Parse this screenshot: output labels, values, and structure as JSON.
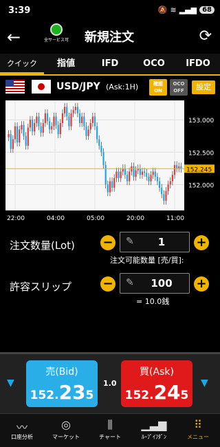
{
  "status": {
    "time": "3:39",
    "battery": "68"
  },
  "header": {
    "service_label": "全サービス可",
    "title": "新規注文"
  },
  "tabs": [
    "クイック",
    "指値",
    "IFD",
    "OCO",
    "IFDO"
  ],
  "pair": {
    "name": "USD/JPY",
    "ask_label": "(Ask:1H)",
    "confirm_title": "確認",
    "confirm_state": "ON",
    "oco_title": "OCO",
    "oco_state": "OFF",
    "settings_label": "設定"
  },
  "chart_data": {
    "type": "candlestick",
    "x_ticks": [
      "22:00",
      "04:00",
      "05:00",
      "20:00",
      "11:00"
    ],
    "y_ticks": [
      "153.000",
      "152.500",
      "152.000"
    ],
    "current_price_label": "152.245",
    "ylim": [
      151.6,
      153.3
    ],
    "current_price": 152.245,
    "up_color": "#e53935",
    "down_color": "#1ba7e8",
    "closes": [
      152.78,
      152.55,
      152.7,
      152.9,
      152.65,
      152.85,
      152.92,
      152.75,
      152.6,
      152.88,
      153.0,
      152.82,
      152.95,
      153.05,
      152.9,
      152.8,
      152.95,
      153.1,
      152.98,
      152.85,
      152.9,
      153.05,
      152.92,
      152.78,
      152.95,
      153.1,
      153.2,
      153.05,
      152.9,
      153.1,
      153.15,
      153.2,
      153.1,
      152.95,
      153.05,
      152.9,
      152.75,
      152.85,
      152.95,
      153.05,
      152.9,
      152.7,
      152.6,
      152.5,
      152.3,
      152.0,
      151.88,
      152.05,
      151.95,
      152.1,
      152.2,
      152.1,
      152.2,
      152.25,
      152.15,
      152.05,
      152.2,
      152.28,
      152.12,
      152.22,
      152.25,
      152.15,
      152.2,
      152.18,
      152.12,
      152.05,
      152.15,
      152.2,
      152.12,
      152.05,
      151.95,
      151.85,
      151.75,
      151.9,
      152.0,
      152.05,
      152.15,
      152.3,
      152.25,
      152.28,
      152.245
    ]
  },
  "order": {
    "qty_label": "注文数量(Lot)",
    "qty_value": "1",
    "qty_note": "注文可能数量 [売/買]:",
    "slip_label": "許容スリップ",
    "slip_value": "100",
    "slip_note": "= 10.0銭",
    "minus": "−",
    "plus": "+"
  },
  "trade": {
    "bid_label": "売(Bid)",
    "bid_head": "152.",
    "bid_big": "23",
    "bid_tail": "5",
    "ask_label": "買(Ask)",
    "ask_head": "152.",
    "ask_big": "24",
    "ask_tail": "5",
    "spread": "1.0"
  },
  "nav": [
    {
      "label": "口座分析",
      "icon": "chart-line-icon"
    },
    {
      "label": "マーケット",
      "icon": "globe-icon"
    },
    {
      "label": "チャート",
      "icon": "candle-icon"
    },
    {
      "label": "ﾙｰﾌﾟｲﾌﾀﾞﾝ",
      "icon": "bar-chart-icon"
    },
    {
      "label": "メニュー",
      "icon": "grid-icon"
    }
  ]
}
